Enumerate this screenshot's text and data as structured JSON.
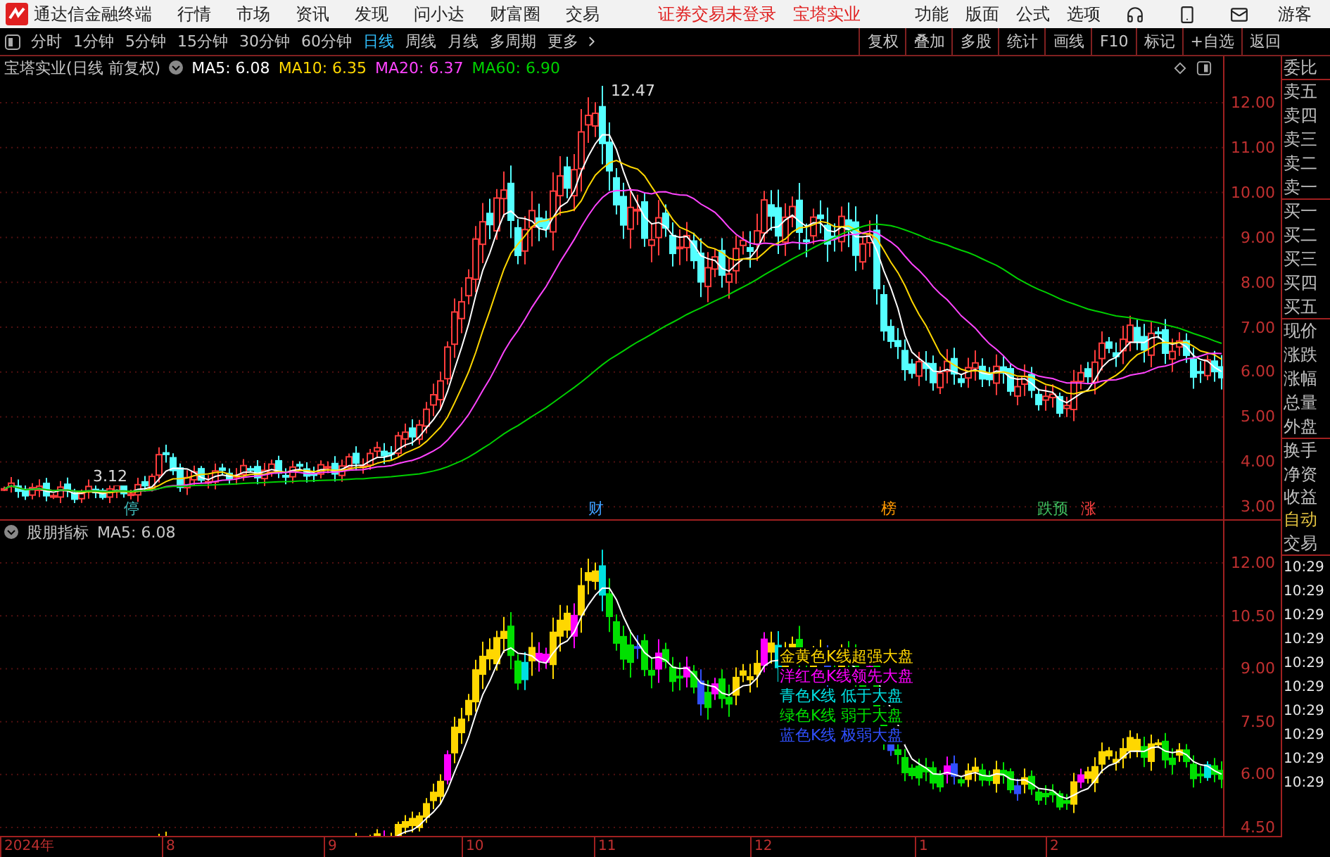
{
  "app": {
    "title": "通达信金融终端",
    "menu": [
      "行情",
      "市场",
      "资讯",
      "发现",
      "问小达",
      "财富圈",
      "交易"
    ],
    "notice": "证券交易未登录",
    "stock": "宝塔实业",
    "right_menu": [
      "功能",
      "版面",
      "公式",
      "选项"
    ],
    "user": "游客"
  },
  "periods": [
    {
      "label": "分时",
      "selected": false
    },
    {
      "label": "1分钟",
      "selected": false
    },
    {
      "label": "5分钟",
      "selected": false
    },
    {
      "label": "15分钟",
      "selected": false
    },
    {
      "label": "30分钟",
      "selected": false
    },
    {
      "label": "60分钟",
      "selected": false
    },
    {
      "label": "日线",
      "selected": true
    },
    {
      "label": "周线",
      "selected": false
    },
    {
      "label": "月线",
      "selected": false
    },
    {
      "label": "多周期",
      "selected": false
    }
  ],
  "more": "更多",
  "tools": [
    "复权",
    "叠加",
    "多股",
    "统计",
    "画线",
    "F10",
    "标记",
    "+自选",
    "返回"
  ],
  "main": {
    "title": "宝塔实业(日线 前复权)",
    "mas": [
      {
        "label": "MA5: 6.08",
        "color": "#ffffff"
      },
      {
        "label": "MA10: 6.35",
        "color": "#ffd700"
      },
      {
        "label": "MA20: 6.37",
        "color": "#ff44ff"
      },
      {
        "label": "MA60: 6.90",
        "color": "#00d000"
      }
    ],
    "yticks": [
      "12.00",
      "11.00",
      "10.00",
      "9.00",
      "8.00",
      "7.00",
      "6.00",
      "5.00",
      "4.00",
      "3.00"
    ],
    "high": "12.47",
    "low": "3.12",
    "events": [
      {
        "label": "停",
        "color": "#40c0c0"
      },
      {
        "label": "财",
        "color": "#40a0ff"
      },
      {
        "label": "榜",
        "color": "#ff9900"
      },
      {
        "label": "跌预",
        "color": "#40c060"
      },
      {
        "label": "涨",
        "color": "#ff4040"
      }
    ]
  },
  "sub": {
    "title": "股朋指标",
    "ma": "MA5: 6.08",
    "legend": [
      {
        "label": "金黄色K线超强大盘",
        "color": "#ffd700"
      },
      {
        "label": "洋红色K线领先大盘",
        "color": "#ff00ff"
      },
      {
        "label": "青色K线 低于大盘",
        "color": "#00e0e0"
      },
      {
        "label": "绿色K线 弱于大盘",
        "color": "#00e000"
      },
      {
        "label": "蓝色K线 极弱大盘",
        "color": "#3050ff"
      }
    ],
    "yticks": [
      "12.00",
      "10.50",
      "9.00",
      "7.50",
      "6.00",
      "4.50"
    ]
  },
  "dates": [
    "2024年",
    "8",
    "9",
    "10",
    "11",
    "12",
    "1",
    "2"
  ],
  "side": {
    "quote": [
      "委比",
      "卖五",
      "卖四",
      "卖三",
      "卖二",
      "卖一",
      "买一",
      "买二",
      "买三",
      "买四",
      "买五",
      "现价",
      "涨跌",
      "涨幅",
      "总量",
      "外盘",
      "换手",
      "净资",
      "收益"
    ],
    "auto": "自动",
    "trade": "交易",
    "times": [
      "10:29",
      "10:29",
      "10:29",
      "10:29",
      "10:29",
      "10:29",
      "10:29",
      "10:29",
      "10:29",
      "10:29"
    ]
  }
}
